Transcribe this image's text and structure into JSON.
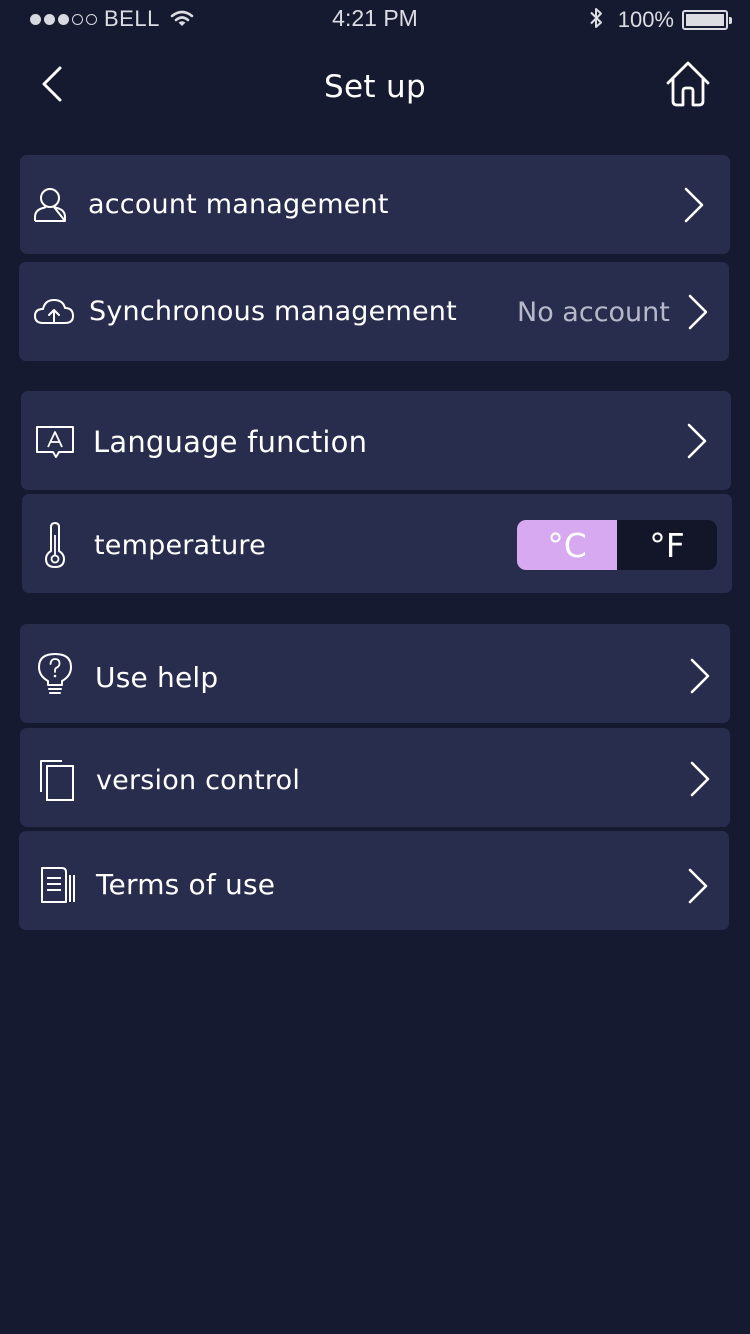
{
  "status_bar": {
    "carrier": "BELL",
    "time": "4:21 PM",
    "battery": "100%",
    "signal_filled": 3,
    "signal_total": 5
  },
  "nav": {
    "title": "Set up",
    "back_icon": "chevron-left-icon",
    "home_icon": "home-icon"
  },
  "settings": {
    "account": {
      "label": "account management",
      "icon": "user-icon"
    },
    "sync": {
      "label": "Synchronous management",
      "value": "No account",
      "icon": "cloud-upload-icon"
    },
    "language": {
      "label": "Language function",
      "icon": "language-icon",
      "icon_text": "A"
    },
    "temperature": {
      "label": "temperature",
      "icon": "thermometer-icon",
      "options": [
        "°C",
        "°F"
      ],
      "selected": "°C"
    },
    "help": {
      "label": "Use help",
      "icon": "help-bulb-icon",
      "icon_text": "?"
    },
    "version": {
      "label": "version control",
      "icon": "copy-icon"
    },
    "terms": {
      "label": "Terms of use",
      "icon": "document-icon"
    }
  },
  "colors": {
    "background": "#161a30",
    "card": "#292d4d",
    "accent": "#d6a9f1",
    "secondary_text": "#b7b9cb"
  }
}
